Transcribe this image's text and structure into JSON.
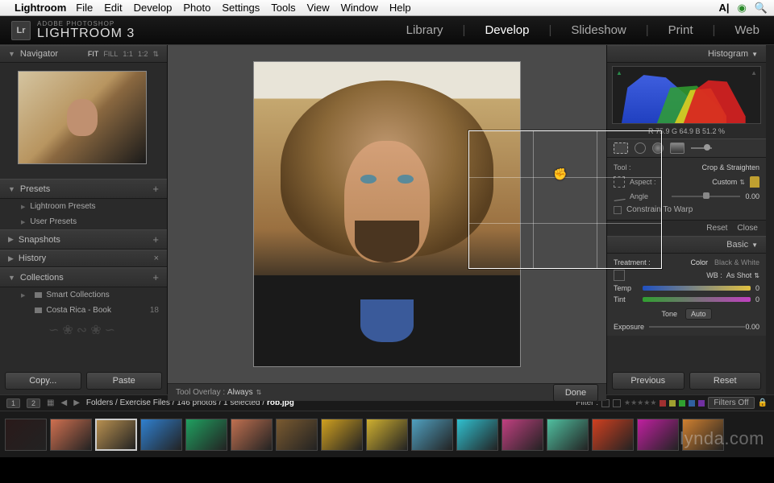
{
  "mac_menu": {
    "app": "Lightroom",
    "items": [
      "File",
      "Edit",
      "Develop",
      "Photo",
      "Settings",
      "Tools",
      "View",
      "Window",
      "Help"
    ]
  },
  "product": {
    "small": "ADOBE PHOTOSHOP",
    "big": "LIGHTROOM 3",
    "badge": "Lr"
  },
  "modules": {
    "items": [
      "Library",
      "Develop",
      "Slideshow",
      "Print",
      "Web"
    ],
    "active": "Develop"
  },
  "left": {
    "navigator": {
      "title": "Navigator",
      "fit_opts": [
        "FIT",
        "FILL",
        "1:1",
        "1:2"
      ],
      "fit_active": "FIT"
    },
    "presets": {
      "title": "Presets",
      "items": [
        "Lightroom Presets",
        "User Presets"
      ]
    },
    "snapshots": {
      "title": "Snapshots"
    },
    "history": {
      "title": "History"
    },
    "collections": {
      "title": "Collections",
      "items": [
        {
          "label": "Smart Collections",
          "count": ""
        },
        {
          "label": "Costa Rica - Book",
          "count": "18"
        }
      ]
    },
    "buttons": {
      "copy": "Copy...",
      "paste": "Paste"
    }
  },
  "center": {
    "tool_overlay_label": "Tool Overlay :",
    "tool_overlay_value": "Always",
    "done": "Done"
  },
  "right": {
    "histogram_title": "Histogram",
    "rgb": "R  75.9   G  64.9   B  51.2 %",
    "tool": {
      "label": "Tool :",
      "name": "Crop & Straighten",
      "aspect_label": "Aspect :",
      "aspect_value": "Custom",
      "angle_label": "Angle",
      "angle_value": "0.00",
      "constrain": "Constrain To Warp",
      "reset": "Reset",
      "close": "Close"
    },
    "basic": {
      "title": "Basic",
      "treatment_label": "Treatment :",
      "color": "Color",
      "bw": "Black & White",
      "wb_label": "WB :",
      "wb_value": "As Shot",
      "temp_label": "Temp",
      "temp_value": "0",
      "tint_label": "Tint",
      "tint_value": "0",
      "tone_label": "Tone",
      "auto": "Auto",
      "exposure_label": "Exposure",
      "exposure_value": "0.00"
    },
    "buttons": {
      "previous": "Previous",
      "reset": "Reset"
    }
  },
  "bottom": {
    "pages": [
      "1",
      "2"
    ],
    "crumb_parts": [
      "Folders",
      "Exercise Files",
      "146 photos",
      "1 selected"
    ],
    "crumb_file": "rob.jpg",
    "filter_label": "Filter :",
    "filters_off": "Filters Off"
  },
  "filmstrip": {
    "colors": [
      "#2a1a1a",
      "#d07050",
      "#b89050",
      "#3080d0",
      "#20a060",
      "#c07050",
      "#7a5a30",
      "#d0a020",
      "#d0b030",
      "#50a0c0",
      "#30c0d0",
      "#c04080",
      "#50c0a0",
      "#d04020",
      "#c020a0",
      "#d08030"
    ],
    "selected_index": 2
  },
  "watermark": "lynda.com"
}
